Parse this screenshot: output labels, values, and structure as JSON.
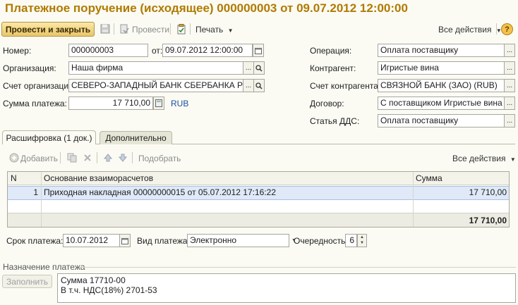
{
  "window": {
    "title": "Платежное поручение (исходящее) 000000003 от 09.07.2012 12:00:00"
  },
  "toolbar": {
    "post_close_label": "Провести и закрыть",
    "post_label": "Провести",
    "print_label": "Печать",
    "all_actions_label": "Все действия",
    "help_label": "?",
    "icons": [
      "save-icon",
      "post-document-icon",
      "clipboard-check-icon",
      "dropdown-arrow-icon",
      "help-icon"
    ]
  },
  "form": {
    "number_label": "Номер:",
    "number_value": "000000003",
    "date_label": "от:",
    "date_value": "09.07.2012 12:00:00",
    "organization_label": "Организация:",
    "organization_value": "Наша фирма",
    "org_account_label": "Счет организации:",
    "org_account_value": "СЕВЕРО-ЗАПАДНЫЙ БАНК СБЕРБАНКА РФ, Н",
    "amount_label": "Сумма платежа:",
    "amount_value": "17 710,00",
    "currency": "RUB",
    "operation_label": "Операция:",
    "operation_value": "Оплата поставщику",
    "counterparty_label": "Контрагент:",
    "counterparty_value": "Игристые вина",
    "counterparty_account_label": "Счет контрагента:",
    "counterparty_account_value": "СВЯЗНОЙ БАНК (ЗАО) (RUB)",
    "contract_label": "Договор:",
    "contract_value": "С поставщиком Игристые вина",
    "dds_label": "Статья ДДС:",
    "dds_value": "Оплата поставщику",
    "select_button": "...",
    "search_icon": "magnifier-icon"
  },
  "tabs": [
    {
      "label": "Расшифровка (1 док.)",
      "active": true
    },
    {
      "label": "Дополнительно",
      "active": false
    }
  ],
  "grid_toolbar": {
    "add_label": "Добавить",
    "pick_label": "Подобрать",
    "all_actions_label": "Все действия"
  },
  "table": {
    "columns": [
      "N",
      "Основание взаиморасчетов",
      "Сумма"
    ],
    "rows": [
      {
        "n": "1",
        "basis": "Приходная накладная 00000000015 от 05.07.2012 17:16:22",
        "sum": "17 710,00"
      }
    ],
    "total": "17 710,00"
  },
  "payment": {
    "due_label": "Срок платежа:",
    "due_value": "10.07.2012",
    "type_label": "Вид платежа:",
    "type_value": "Электронно",
    "priority_label": "Очередность:",
    "priority_value": "6"
  },
  "purpose": {
    "section_label": "Назначение платежа",
    "fill_label": "Заполнить",
    "line1": "Сумма 17710-00",
    "line2": "В т.ч. НДС(18%) 2701-53"
  }
}
